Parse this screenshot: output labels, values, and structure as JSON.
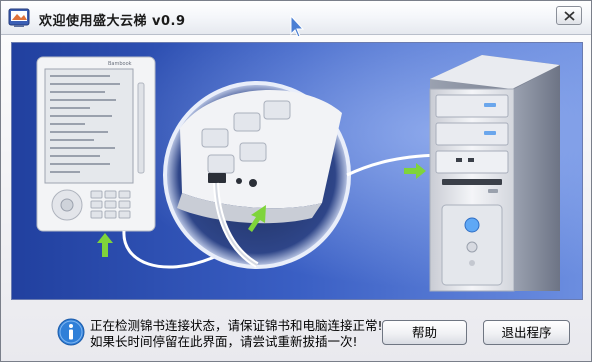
{
  "window": {
    "title": "欢迎使用盛大云梯 v0.9"
  },
  "scene": {
    "device_brand": "Bambook"
  },
  "status": {
    "line1": "正在检测锦书连接状态，请保证锦书和电脑连接正常!",
    "line2": "如果长时间停留在此界面，请尝试重新拔插一次!"
  },
  "buttons": {
    "help": "帮助",
    "exit": "退出程序"
  },
  "colors": {
    "scene_bg": "#2a4aa8",
    "arrow_green": "#7fd43b",
    "info_blue": "#2f7fd8"
  },
  "icons": {
    "app": "app-icon",
    "close": "close-icon",
    "info": "info-icon",
    "cursor": "cursor-icon"
  }
}
